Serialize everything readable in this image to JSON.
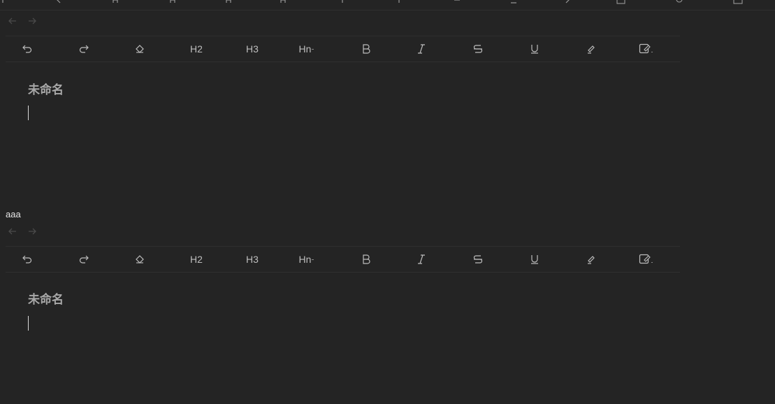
{
  "top_strip": {
    "icons": [
      "redo-icon",
      "eraser-icon",
      "heading-icon",
      "heading-icon",
      "heading-icon",
      "bold-icon",
      "italic-icon",
      "strike-icon",
      "underline-icon",
      "highlight-icon",
      "edit-icon",
      "table-icon",
      "link-icon",
      "expand-icon"
    ]
  },
  "editor_top": {
    "toolbar": {
      "undo": "undo-icon",
      "redo": "redo-icon",
      "clear_format": "eraser-icon",
      "h2": "H2",
      "h3": "H3",
      "hn": "Hn",
      "bold": "bold-icon",
      "italic": "italic-icon",
      "strike": "strikethrough-icon",
      "underline": "underline-icon",
      "highlight": "highlight-icon",
      "edit": "edit-icon"
    },
    "title": "未命名"
  },
  "between_text": "aaa",
  "editor_bottom": {
    "title": "未命名"
  },
  "colors": {
    "background": "#242424",
    "icon": "#bdbdbd",
    "nav_disabled": "#4a4a4a",
    "title": "#a8a8a8"
  }
}
